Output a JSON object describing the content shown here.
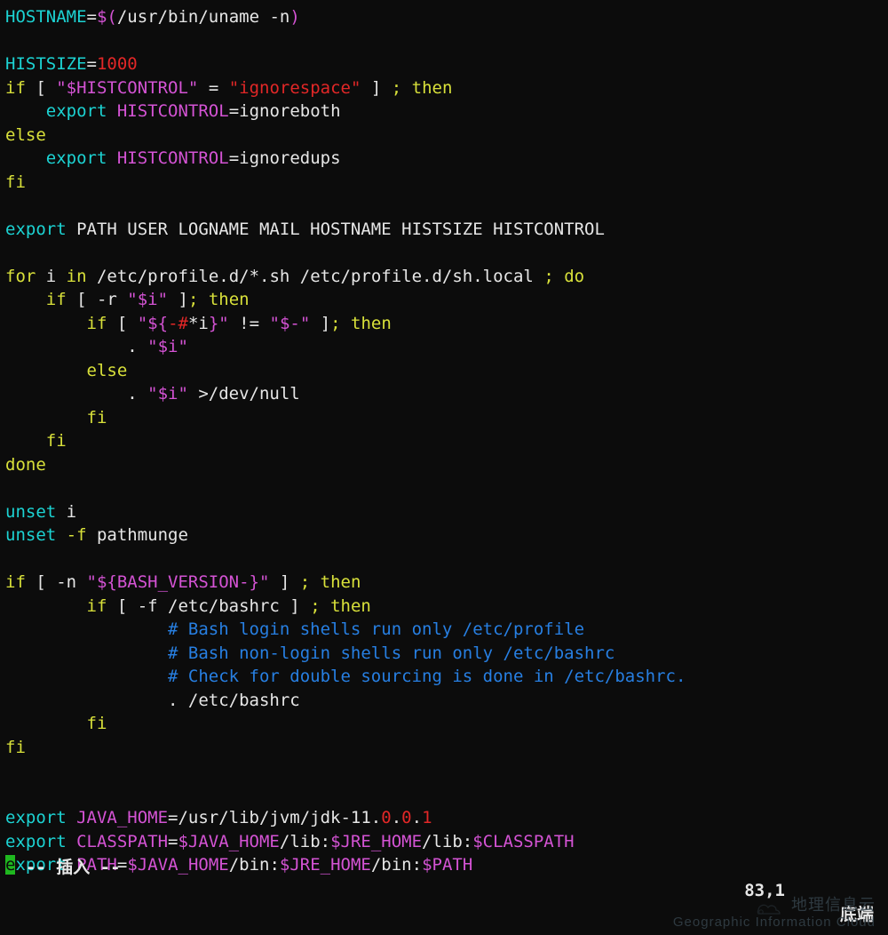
{
  "lines": [
    [
      [
        "c",
        "HOSTNAME"
      ],
      [
        "w",
        "="
      ],
      [
        "m",
        "$("
      ],
      [
        "w",
        "/usr/bin/uname -n"
      ],
      [
        "m",
        ")"
      ]
    ],
    [],
    [
      [
        "c",
        "HISTSIZE"
      ],
      [
        "w",
        "="
      ],
      [
        "r",
        "1000"
      ]
    ],
    [
      [
        "y",
        "if"
      ],
      [
        "w",
        " [ "
      ],
      [
        "m",
        "\"$HISTCONTROL\""
      ],
      [
        "w",
        " = "
      ],
      [
        "r",
        "\"ignorespace\""
      ],
      [
        "w",
        " ] "
      ],
      [
        "y",
        ";"
      ],
      [
        "w",
        " "
      ],
      [
        "y",
        "then"
      ]
    ],
    [
      [
        "w",
        "    "
      ],
      [
        "c",
        "export "
      ],
      [
        "m",
        "HISTCONTROL"
      ],
      [
        "w",
        "=ignoreboth"
      ]
    ],
    [
      [
        "y",
        "else"
      ]
    ],
    [
      [
        "w",
        "    "
      ],
      [
        "c",
        "export "
      ],
      [
        "m",
        "HISTCONTROL"
      ],
      [
        "w",
        "=ignoredups"
      ]
    ],
    [
      [
        "y",
        "fi"
      ]
    ],
    [],
    [
      [
        "c",
        "export"
      ],
      [
        "w",
        " PATH USER LOGNAME MAIL HOSTNAME HISTSIZE HISTCONTROL"
      ]
    ],
    [],
    [
      [
        "y",
        "for"
      ],
      [
        "w",
        " i "
      ],
      [
        "y",
        "in"
      ],
      [
        "w",
        " /etc/profile.d/*.sh /etc/profile.d/sh.local "
      ],
      [
        "y",
        ";"
      ],
      [
        "w",
        " "
      ],
      [
        "y",
        "do"
      ]
    ],
    [
      [
        "w",
        "    "
      ],
      [
        "y",
        "if"
      ],
      [
        "w",
        " [ -r "
      ],
      [
        "m",
        "\"$i\""
      ],
      [
        "w",
        " ]"
      ],
      [
        "y",
        "; then"
      ]
    ],
    [
      [
        "w",
        "        "
      ],
      [
        "y",
        "if"
      ],
      [
        "w",
        " [ "
      ],
      [
        "m",
        "\"${"
      ],
      [
        "r",
        "-#"
      ],
      [
        "w",
        "*i"
      ],
      [
        "m",
        "}\""
      ],
      [
        "w",
        " != "
      ],
      [
        "m",
        "\"$-\""
      ],
      [
        "w",
        " ]"
      ],
      [
        "y",
        "; then"
      ]
    ],
    [
      [
        "w",
        "            . "
      ],
      [
        "m",
        "\"$i\""
      ]
    ],
    [
      [
        "w",
        "        "
      ],
      [
        "y",
        "else"
      ]
    ],
    [
      [
        "w",
        "            . "
      ],
      [
        "m",
        "\"$i\""
      ],
      [
        "w",
        " >/dev/null"
      ]
    ],
    [
      [
        "w",
        "        "
      ],
      [
        "y",
        "fi"
      ]
    ],
    [
      [
        "w",
        "    "
      ],
      [
        "y",
        "fi"
      ]
    ],
    [
      [
        "y",
        "done"
      ]
    ],
    [],
    [
      [
        "c",
        "unset"
      ],
      [
        "w",
        " i"
      ]
    ],
    [
      [
        "c",
        "unset"
      ],
      [
        "y",
        " -f"
      ],
      [
        "w",
        " pathmunge"
      ]
    ],
    [],
    [
      [
        "y",
        "if"
      ],
      [
        "w",
        " [ -n "
      ],
      [
        "m",
        "\"${BASH_VERSION-}\""
      ],
      [
        "w",
        " ] "
      ],
      [
        "y",
        ";"
      ],
      [
        "w",
        " "
      ],
      [
        "y",
        "then"
      ]
    ],
    [
      [
        "w",
        "        "
      ],
      [
        "y",
        "if"
      ],
      [
        "w",
        " [ -f /etc/bashrc ] "
      ],
      [
        "y",
        ";"
      ],
      [
        "w",
        " "
      ],
      [
        "y",
        "then"
      ]
    ],
    [
      [
        "w",
        "                "
      ],
      [
        "b",
        "# Bash login shells run only /etc/profile"
      ]
    ],
    [
      [
        "w",
        "                "
      ],
      [
        "b",
        "# Bash non-login shells run only /etc/bashrc"
      ]
    ],
    [
      [
        "w",
        "                "
      ],
      [
        "b",
        "# Check for double sourcing is done in /etc/bashrc."
      ]
    ],
    [
      [
        "w",
        "                . /etc/bashrc"
      ]
    ],
    [
      [
        "w",
        "        "
      ],
      [
        "y",
        "fi"
      ]
    ],
    [
      [
        "y",
        "fi"
      ]
    ],
    [],
    [],
    [
      [
        "c",
        "export "
      ],
      [
        "m",
        "JAVA_HOME"
      ],
      [
        "w",
        "=/usr/lib/jvm/jdk-11."
      ],
      [
        "r",
        "0"
      ],
      [
        "w",
        "."
      ],
      [
        "r",
        "0"
      ],
      [
        "w",
        "."
      ],
      [
        "r",
        "1"
      ]
    ],
    [
      [
        "c",
        "export "
      ],
      [
        "m",
        "CLASSPATH"
      ],
      [
        "w",
        "="
      ],
      [
        "m",
        "$JAVA_HOME"
      ],
      [
        "w",
        "/lib:"
      ],
      [
        "m",
        "$JRE_HOME"
      ],
      [
        "w",
        "/lib:"
      ],
      [
        "m",
        "$CLASSPATH"
      ]
    ],
    [
      [
        "cursor",
        "e"
      ],
      [
        "c",
        "xport "
      ],
      [
        "m",
        "PATH"
      ],
      [
        "w",
        "="
      ],
      [
        "m",
        "$JAVA_HOME"
      ],
      [
        "w",
        "/bin:"
      ],
      [
        "m",
        "$JRE_HOME"
      ],
      [
        "w",
        "/bin:"
      ],
      [
        "m",
        "$PATH"
      ]
    ]
  ],
  "status": {
    "mode": "-- 插入 --",
    "position": "83,1",
    "end_marker": "底端"
  },
  "watermark": {
    "title": "地理信息云",
    "subtitle": "Geographic Information Cloud"
  }
}
